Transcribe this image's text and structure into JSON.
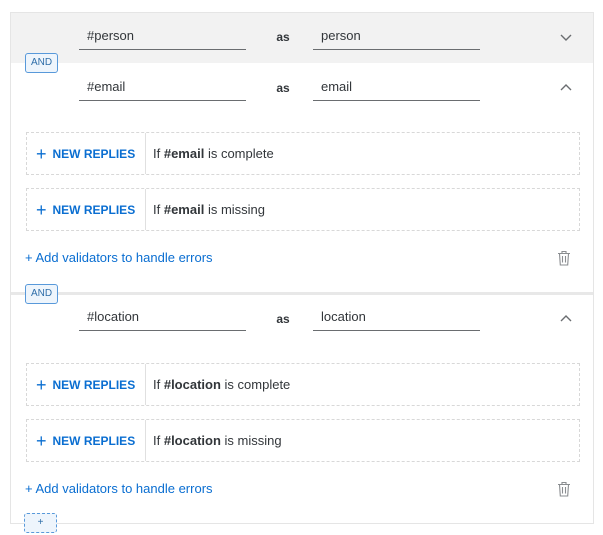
{
  "rows": [
    {
      "entity": "#person",
      "as": "as",
      "variable": "person",
      "expanded": false
    },
    {
      "connector": "AND",
      "entity": "#email",
      "as": "as",
      "variable": "email",
      "expanded": true,
      "replies": [
        {
          "button": "NEW REPLIES",
          "prefix": "If ",
          "entity": "#email",
          "suffix": " is complete"
        },
        {
          "button": "NEW REPLIES",
          "prefix": "If ",
          "entity": "#email",
          "suffix": " is missing"
        }
      ],
      "add_validators": "+ Add validators to handle errors"
    },
    {
      "connector": "AND",
      "entity": "#location",
      "as": "as",
      "variable": "location",
      "expanded": true,
      "replies": [
        {
          "button": "NEW REPLIES",
          "prefix": "If ",
          "entity": "#location",
          "suffix": " is complete"
        },
        {
          "button": "NEW REPLIES",
          "prefix": "If ",
          "entity": "#location",
          "suffix": " is missing"
        }
      ],
      "add_validators": "+ Add validators to handle errors"
    }
  ],
  "add_condition": "+",
  "icons": {
    "collapsed": "chevron-down-icon",
    "expanded": "chevron-up-icon",
    "delete": "trash-icon",
    "add": "plus-icon"
  },
  "colors": {
    "accent": "#0a6ed1",
    "badge_border": "#5899da",
    "header_bg": "#f2f2f2"
  }
}
